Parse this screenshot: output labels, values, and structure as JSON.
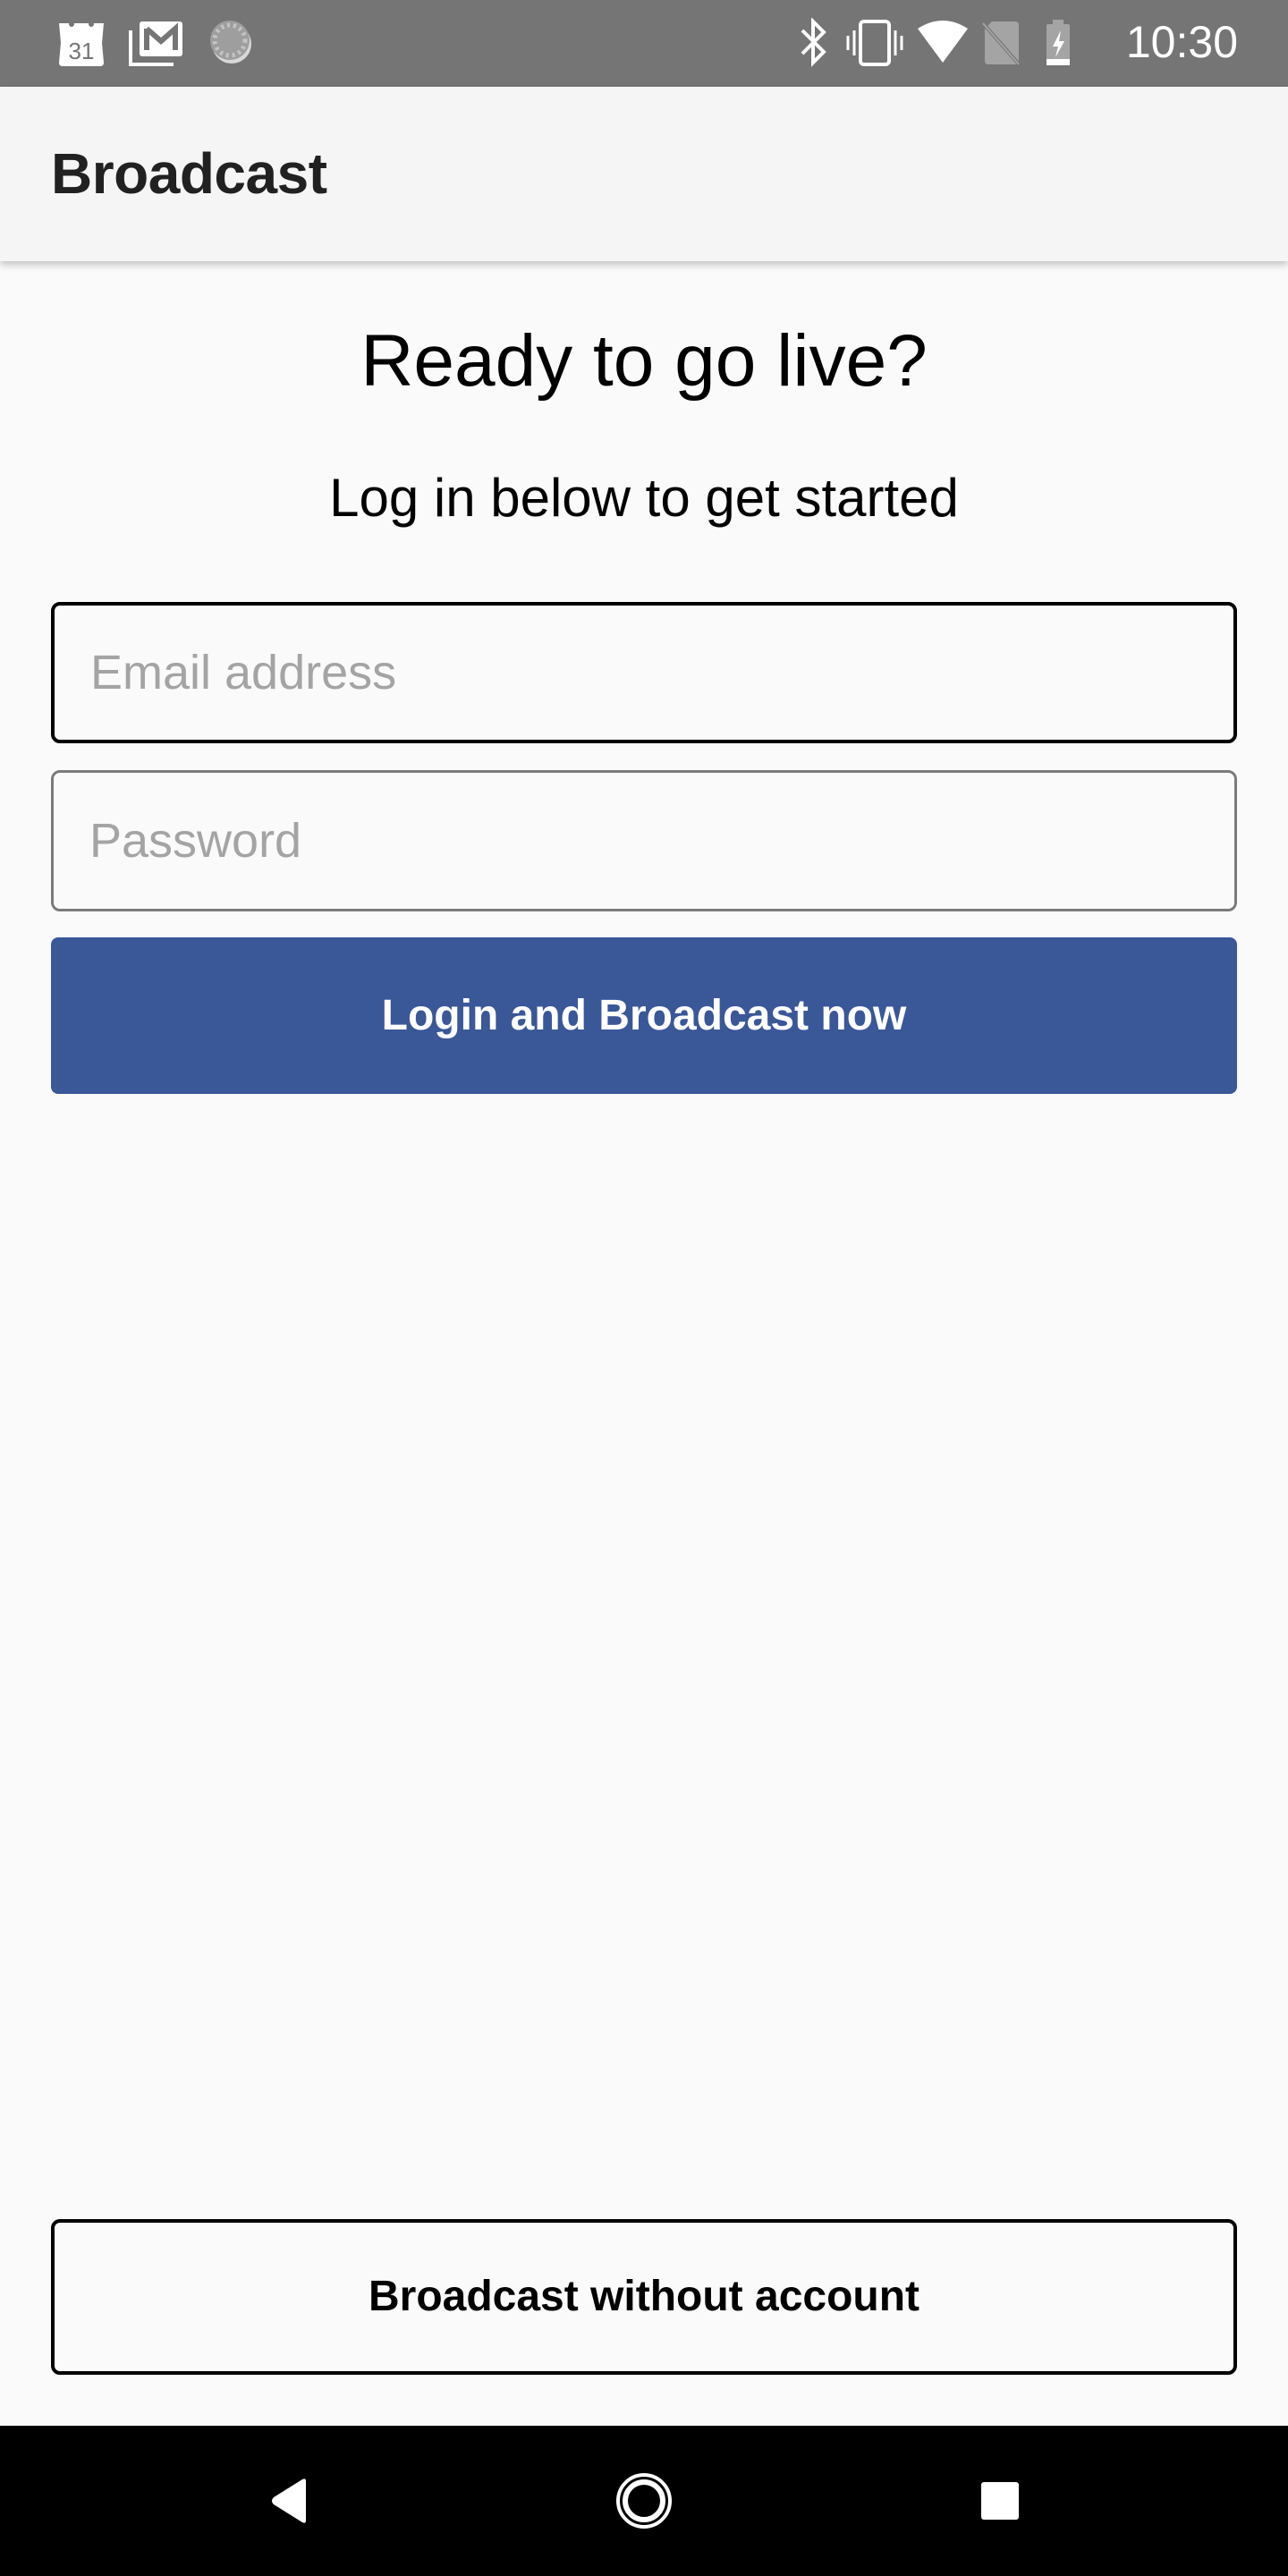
{
  "status_bar": {
    "left_icons": [
      "calendar-icon",
      "gmail-icon",
      "sync-icon"
    ],
    "calendar_day": "31",
    "right_icons": [
      "bluetooth-icon",
      "vibrate-icon",
      "wifi-icon",
      "no-sim-icon",
      "battery-charging-icon"
    ],
    "time": "10:30"
  },
  "app_bar": {
    "title": "Broadcast"
  },
  "main": {
    "heading": "Ready to go live?",
    "subheading": "Log in below to get started",
    "email_field": {
      "value": "",
      "placeholder": "Email address"
    },
    "password_field": {
      "value": "",
      "placeholder": "Password"
    },
    "login_button_label": "Login and Broadcast now",
    "no_account_button_label": "Broadcast without account"
  },
  "colors": {
    "primary": "#3a5798",
    "status_bar": "#757575",
    "app_bar": "#f5f5f5",
    "background": "#fafafa"
  },
  "nav_bar": {
    "buttons": [
      "back-icon",
      "home-icon",
      "recents-icon"
    ]
  }
}
